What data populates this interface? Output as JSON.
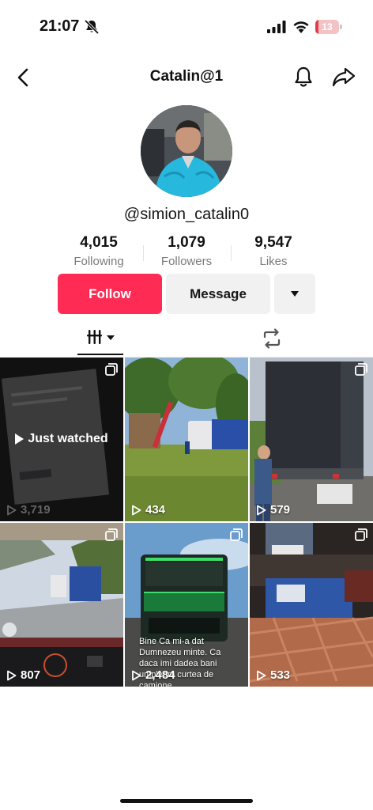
{
  "status_bar": {
    "time": "21:07",
    "battery_percent": "13",
    "battery_level": 0.13,
    "battery_color": "#e23b4a",
    "icons": [
      "mute-bell-icon",
      "cellular-signal-icon",
      "wifi-icon",
      "battery-charging-icon"
    ]
  },
  "header": {
    "title": "Catalin@1",
    "icons": [
      "back-chevron-icon",
      "notification-bell-icon",
      "share-arrow-icon"
    ]
  },
  "profile": {
    "username": "@simion_catalin0",
    "avatar": "avatar-photo"
  },
  "stats": [
    {
      "value": "4,015",
      "label": "Following"
    },
    {
      "value": "1,079",
      "label": "Followers"
    },
    {
      "value": "9,547",
      "label": "Likes"
    }
  ],
  "actions": {
    "follow_label": "Follow",
    "message_label": "Message",
    "more_icon": "caret-down-icon",
    "accent_color": "#fe2c55"
  },
  "tabs": {
    "active": "videos",
    "items": [
      "videos-grid-filter-icon",
      "repost-icon"
    ]
  },
  "videos": [
    {
      "views": "3,719",
      "overlay": "Just watched",
      "multi": true
    },
    {
      "views": "434",
      "multi": false
    },
    {
      "views": "579",
      "multi": true
    },
    {
      "views": "807",
      "multi": true
    },
    {
      "views": "2,484",
      "caption": "Bine Ca mi-a dat Dumnezeu minte. Ca daca imi dadea bani umpleam curtea de camione",
      "multi": true
    },
    {
      "views": "533",
      "multi": true
    }
  ]
}
